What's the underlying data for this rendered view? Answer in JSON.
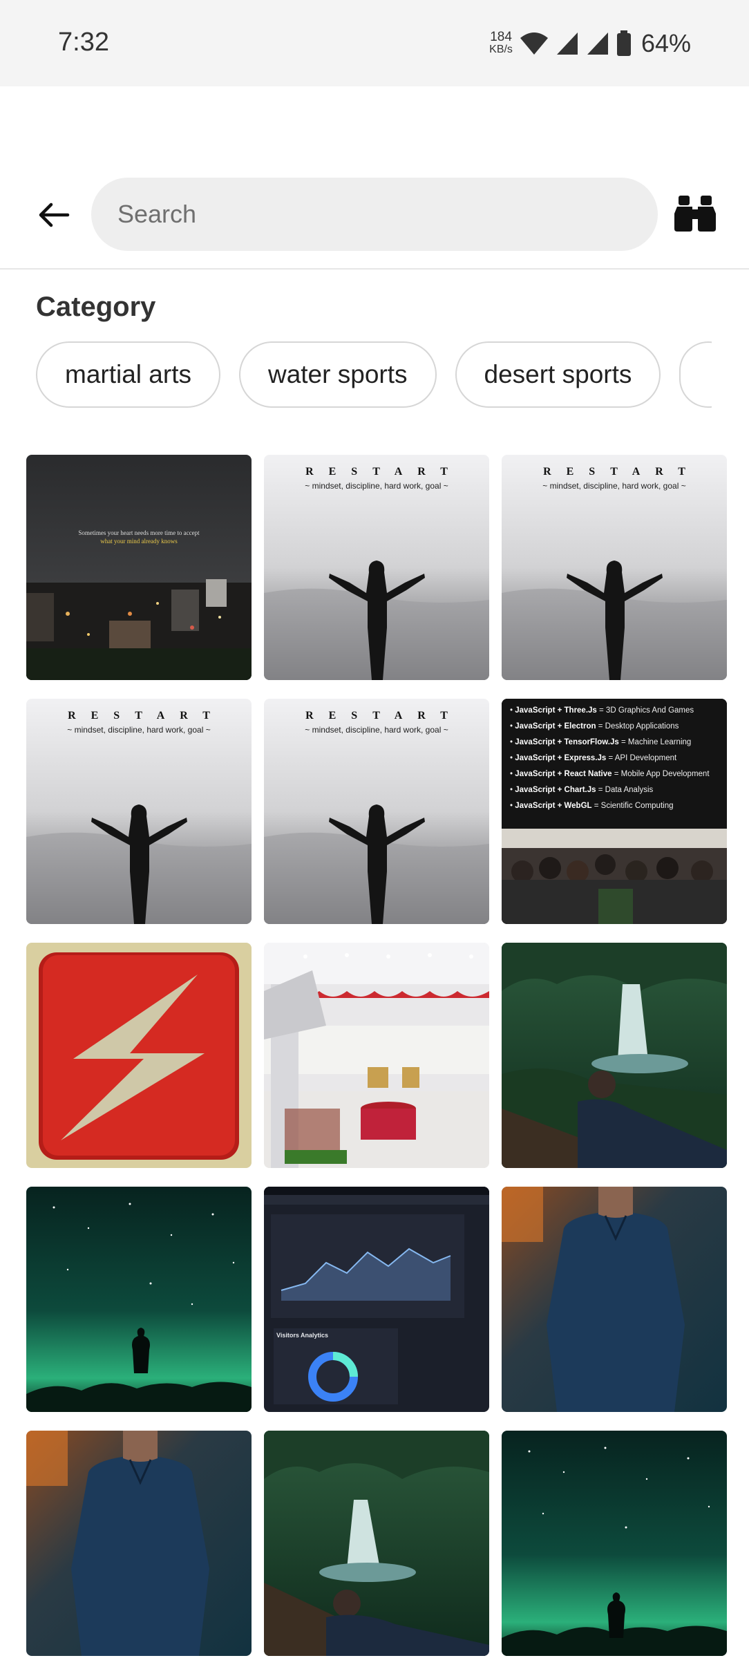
{
  "status_bar": {
    "time": "7:32",
    "net_speed_value": "184",
    "net_speed_unit": "KB/s",
    "battery": "64%",
    "icons": [
      "wifi-icon",
      "signal-icon",
      "signal-icon",
      "battery-icon"
    ]
  },
  "top_bar": {
    "back_icon": "arrow-left-icon",
    "search_placeholder": "Search",
    "action_icon": "binoculars-icon"
  },
  "category": {
    "title": "Category",
    "chips": [
      "martial arts",
      "water sports",
      "desert sports"
    ]
  },
  "texts": {
    "restart_title": "RESTART",
    "restart_subtitle": "~ mindset, discipline, hard work, goal ~",
    "city_quote_line1": "Sometimes your heart needs more time to accept",
    "city_quote_line2": "what your mind already knows",
    "js_lines": [
      {
        "tech": "JavaScript + Three.Js",
        "use": " = 3D Graphics And Games"
      },
      {
        "tech": "JavaScript + Electron",
        "use": " = Desktop Applications"
      },
      {
        "tech": "JavaScript + TensorFlow.Js",
        "use": " = Machine Learning"
      },
      {
        "tech": "JavaScript + Express.Js",
        "use": " = API Development"
      },
      {
        "tech": "JavaScript + React Native",
        "use": " = Mobile App Development"
      },
      {
        "tech": "JavaScript + Chart.Js",
        "use": " = Data Analysis"
      },
      {
        "tech": "JavaScript + WebGL",
        "use": " = Scientific Computing"
      }
    ],
    "dashboard_title": "Visitors Analytics"
  },
  "colors": {
    "accent_red": "#d52a22",
    "forest_green": "#1e6b4a",
    "night_sky": "#0b2a2a"
  }
}
